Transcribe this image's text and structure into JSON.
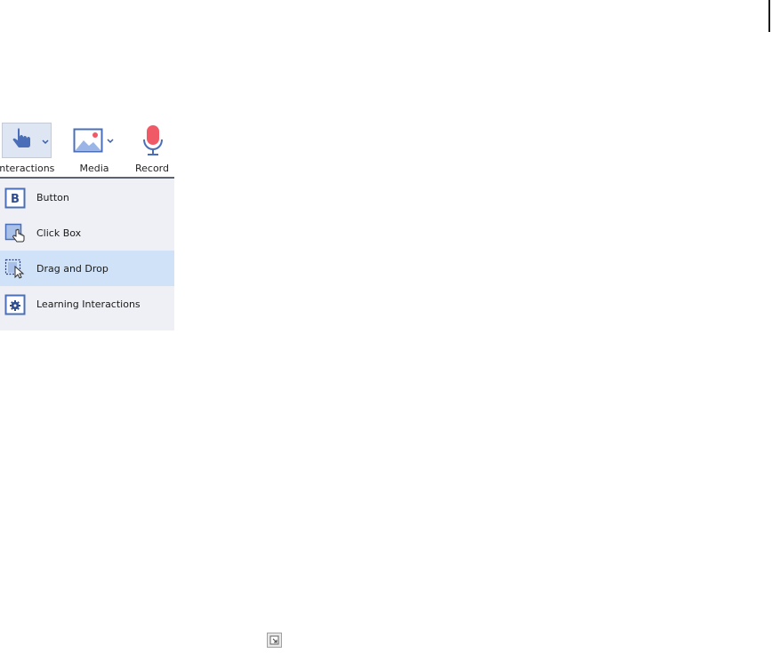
{
  "toolbar": {
    "items": [
      {
        "label": "Interactions",
        "icon": "hand-pointer-icon",
        "has_dropdown": true,
        "active": true
      },
      {
        "label": "Media",
        "icon": "image-icon",
        "has_dropdown": true
      },
      {
        "label": "Record",
        "icon": "microphone-icon",
        "has_dropdown": false
      }
    ]
  },
  "menu": {
    "items": [
      {
        "label": "Button",
        "icon": "button-b-icon"
      },
      {
        "label": "Click Box",
        "icon": "click-box-icon"
      },
      {
        "label": "Drag and Drop",
        "icon": "drag-drop-icon",
        "highlighted": true
      },
      {
        "label": "Learning Interactions",
        "icon": "gear-box-icon"
      }
    ]
  },
  "colors": {
    "accent": "#5b86d6",
    "record": "#f05a66",
    "highlight": "#cfe2f8",
    "menu_bg": "#eff0f6"
  }
}
